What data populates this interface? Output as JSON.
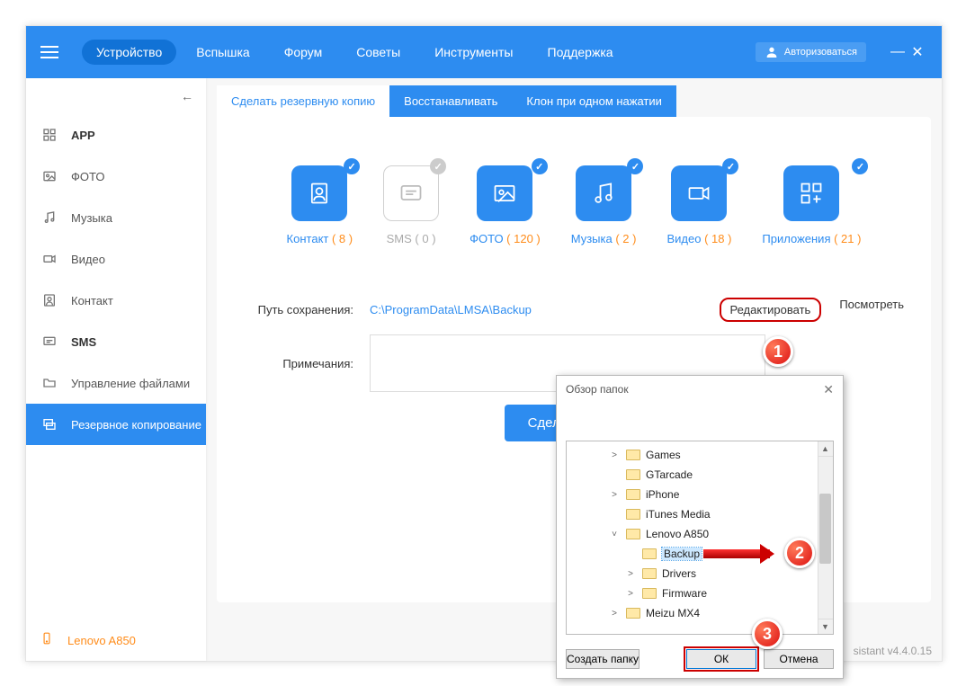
{
  "nav": {
    "items": [
      "Устройство",
      "Вспышка",
      "Форум",
      "Советы",
      "Инструменты",
      "Поддержка"
    ],
    "active": 0,
    "auth_label": "Авторизоваться"
  },
  "sidebar": {
    "items": [
      {
        "label": "APP",
        "bold": true
      },
      {
        "label": "ФОТО"
      },
      {
        "label": "Музыка"
      },
      {
        "label": "Видео"
      },
      {
        "label": "Контакт"
      },
      {
        "label": "SMS",
        "bold": true
      },
      {
        "label": "Управление файлами"
      },
      {
        "label": "Резервное копирование",
        "active": true
      }
    ],
    "device": "Lenovo A850"
  },
  "tabs": [
    "Сделать резервную копию",
    "Восстанавливать",
    "Клон при одном нажатии"
  ],
  "active_tab": 0,
  "categories": [
    {
      "label": "Контакт",
      "count": "( 8 )",
      "icon": "contact",
      "enabled": true
    },
    {
      "label": "SMS",
      "count": "( 0 )",
      "icon": "sms",
      "enabled": false
    },
    {
      "label": "ФОТО",
      "count": "( 120 )",
      "icon": "photo",
      "enabled": true
    },
    {
      "label": "Музыка",
      "count": "( 2 )",
      "icon": "music",
      "enabled": true
    },
    {
      "label": "Видео",
      "count": "( 18 )",
      "icon": "video",
      "enabled": true
    },
    {
      "label": "Приложения",
      "count": "( 21 )",
      "icon": "apps",
      "enabled": true
    }
  ],
  "path_row": {
    "label": "Путь сохранения:",
    "value": "C:\\ProgramData\\LMSA\\Backup",
    "edit": "Редактировать",
    "view": "Посмотреть"
  },
  "notes_label": "Примечания:",
  "backup_btn": "Сделать резервную копию",
  "backup_btn_visible": "Сделать резер",
  "dialog": {
    "title": "Обзор папок",
    "tree": [
      {
        "name": "Games",
        "depth": 2,
        "exp": ">"
      },
      {
        "name": "GTarcade",
        "depth": 2,
        "exp": ""
      },
      {
        "name": "iPhone",
        "depth": 2,
        "exp": ">"
      },
      {
        "name": "iTunes Media",
        "depth": 2,
        "exp": ""
      },
      {
        "name": "Lenovo A850",
        "depth": 2,
        "exp": "v"
      },
      {
        "name": "Backup",
        "depth": 3,
        "exp": "",
        "selected": true
      },
      {
        "name": "Drivers",
        "depth": 3,
        "exp": ">"
      },
      {
        "name": "Firmware",
        "depth": 3,
        "exp": ">"
      },
      {
        "name": "Meizu MX4",
        "depth": 2,
        "exp": ">"
      }
    ],
    "make_folder": "Создать папку",
    "ok": "ОК",
    "cancel": "Отмена"
  },
  "version": "sistant v4.4.0.15",
  "badges": [
    "1",
    "2",
    "3"
  ]
}
